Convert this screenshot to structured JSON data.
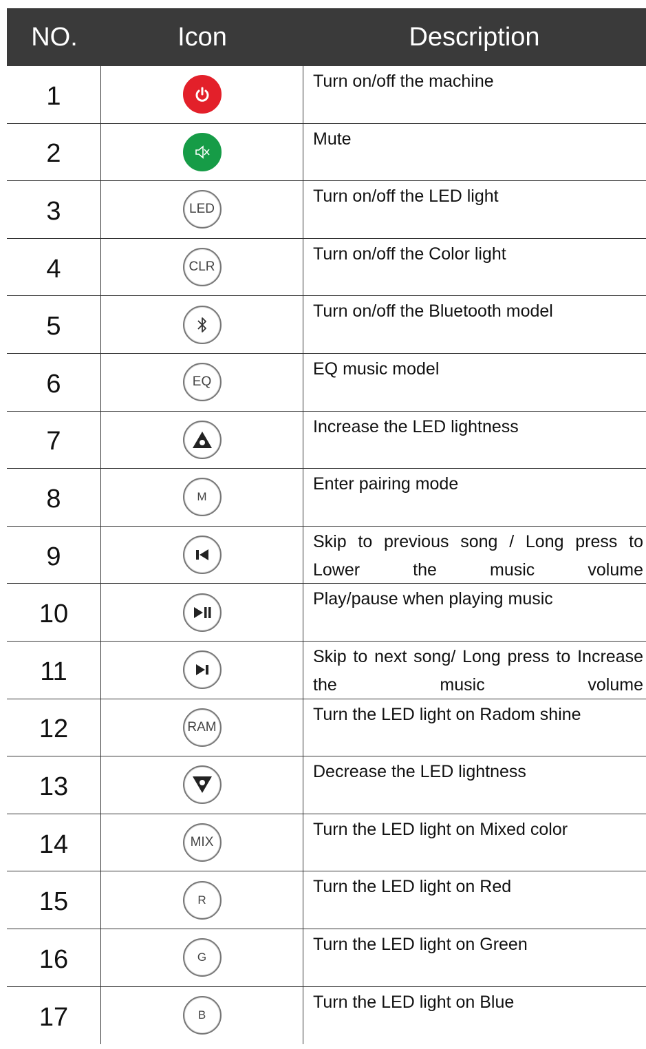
{
  "header": {
    "no": "NO.",
    "icon": "Icon",
    "description": "Description"
  },
  "rows": [
    {
      "no": "1",
      "icon": "power-icon",
      "description": "Turn on/off the machine"
    },
    {
      "no": "2",
      "icon": "mute-icon",
      "description": "Mute"
    },
    {
      "no": "3",
      "icon": "led-icon",
      "icon_text": "LED",
      "description": "Turn on/off the LED light"
    },
    {
      "no": "4",
      "icon": "clr-icon",
      "icon_text": "CLR",
      "description": "Turn on/off the Color light"
    },
    {
      "no": "5",
      "icon": "bluetooth-icon",
      "description": "Turn on/off the Bluetooth model"
    },
    {
      "no": "6",
      "icon": "eq-icon",
      "icon_text": "EQ",
      "description": "EQ music model"
    },
    {
      "no": "7",
      "icon": "brightness-up-icon",
      "description": "Increase the LED lightness"
    },
    {
      "no": "8",
      "icon": "m-icon",
      "icon_text": "M",
      "description": "Enter pairing mode"
    },
    {
      "no": "9",
      "icon": "previous-icon",
      "description": "Skip to previous song / Long press to Lower the music volume"
    },
    {
      "no": "10",
      "icon": "play-pause-icon",
      "description": "Play/pause when playing music"
    },
    {
      "no": "11",
      "icon": "next-icon",
      "description": "Skip to next song/ Long press to Increase the music volume"
    },
    {
      "no": "12",
      "icon": "ram-icon",
      "icon_text": "RAM",
      "description": "Turn the LED light on Radom shine"
    },
    {
      "no": "13",
      "icon": "brightness-down-icon",
      "description": "Decrease the LED lightness"
    },
    {
      "no": "14",
      "icon": "mix-icon",
      "icon_text": "MIX",
      "description": "Turn the LED light on Mixed color"
    },
    {
      "no": "15",
      "icon": "r-icon",
      "icon_text": "R",
      "description": "Turn the LED light on Red"
    },
    {
      "no": "16",
      "icon": "g-icon",
      "icon_text": "G",
      "description": "Turn the LED light on Green"
    },
    {
      "no": "17",
      "icon": "b-icon",
      "icon_text": "B",
      "description": "Turn the LED light on Blue"
    }
  ],
  "colors": {
    "header_bg": "#3a3a3a",
    "power_red": "#e3202a",
    "mute_green": "#169c47"
  }
}
